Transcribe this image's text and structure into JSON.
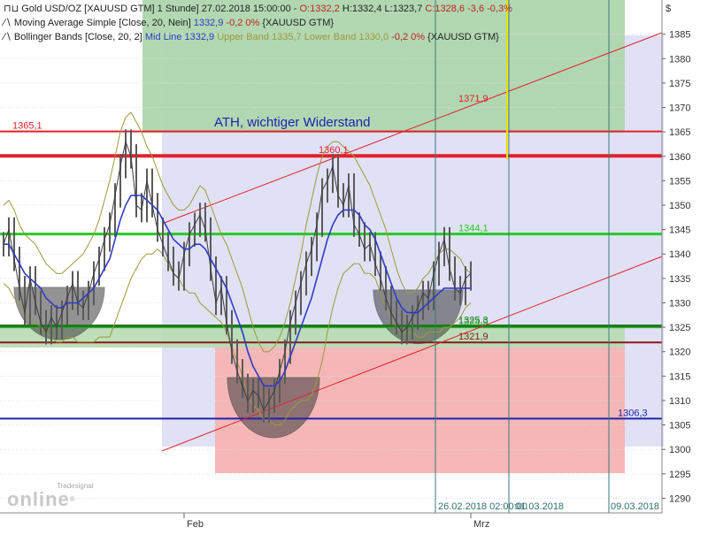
{
  "legend": {
    "l1": {
      "icon": "candles-icon",
      "main": "Gold USD/OZ [XAUUSD GTM]  1 Stunde] 27.02.2018 15:00:00 - ",
      "o": "O:1332,2",
      "h": " H:1332,4 L:1323,7 ",
      "c": "C:1328,6 -3,6 -0,3%"
    },
    "l2": {
      "icon": "line-icon",
      "main": "Moving Average Simple [Close, 20, Nein] ",
      "val": "1332,9",
      "chg": " -0,2 0%",
      "tail": " {XAUUSD GTM}"
    },
    "l3": {
      "icon": "line-icon",
      "main": "Bollinger Bands [Close, 20, 2] ",
      "mid": "Mid Line 1332,9",
      "up": " Upper Band 1335,7",
      "low": " Lower Band 1330,0",
      "chg": " -0,2 0%",
      "tail": " {XAUUSD GTM}"
    }
  },
  "logo": {
    "small": "Tradesignal",
    "big": "online",
    "registered": "®"
  },
  "colors": {
    "price": "#5a5a5a",
    "sma": "#2f3bc4",
    "bollinger": "#9c9a3c",
    "red_level": "#e3202a",
    "green_level": "#22cc22",
    "dark_green": "#1f7a1f",
    "dark_red": "#8a1a1a",
    "blue_level": "#2222aa",
    "yellow_line": "#f0e000"
  },
  "chart_data": {
    "type": "line",
    "title": "",
    "currency_label": "$",
    "x_labels": [
      {
        "label": "Feb",
        "bar": 34
      },
      {
        "label": "Mrz",
        "bar": 88
      }
    ],
    "bars_total": 122,
    "ylim": [
      1287,
      1392
    ],
    "y_ticks": [
      1290,
      1295,
      1300,
      1305,
      1310,
      1315,
      1320,
      1325,
      1330,
      1335,
      1340,
      1345,
      1350,
      1355,
      1360,
      1365,
      1370,
      1375,
      1380,
      1385
    ],
    "annotation_text": "ATH, wichtiger Widerstand",
    "date_labels": [
      "26.02.2018 02:00:00",
      "01.03.2018",
      "09.03.2018"
    ],
    "levels": [
      {
        "name": "ath",
        "value": 1365.1,
        "label": "1365,1",
        "color": "#e3202a",
        "width": 2
      },
      {
        "name": "major-resistance",
        "value": 1360.1,
        "label": "1360,1",
        "color": "#e3202a",
        "width": 4
      },
      {
        "name": "green-resistance",
        "value": 1344.1,
        "label": "1344,1",
        "color": "#22cc22",
        "width": 3
      },
      {
        "name": "upper-support",
        "value": 1325.3,
        "label": "1325,3",
        "color": "#1f7a1f",
        "width": 3
      },
      {
        "name": "mid-support",
        "value": 1324.9,
        "label": "1324,9",
        "color": "#22aa22",
        "width": 1
      },
      {
        "name": "lower-support",
        "value": 1321.9,
        "label": "1321,9",
        "color": "#8a1a1a",
        "width": 2
      },
      {
        "name": "deep-support",
        "value": 1306.3,
        "label": "1306,3",
        "color": "#2222aa",
        "width": 2
      }
    ],
    "channel_label": {
      "value": 1371.9,
      "label": "1371,9"
    },
    "price": [
      1342,
      1345,
      1339,
      1333,
      1328,
      1335,
      1330,
      1326,
      1324,
      1327,
      1325,
      1328,
      1331,
      1334,
      1330,
      1329,
      1332,
      1336,
      1339,
      1343,
      1346,
      1352,
      1358,
      1363,
      1360,
      1350,
      1349,
      1355,
      1350,
      1345,
      1342,
      1339,
      1336,
      1335,
      1340,
      1344,
      1346,
      1348,
      1345,
      1337,
      1330,
      1333,
      1326,
      1320,
      1316,
      1313,
      1310,
      1312,
      1311,
      1308,
      1310,
      1312,
      1316,
      1320,
      1326,
      1330,
      1334,
      1338,
      1341,
      1346,
      1353,
      1355,
      1358,
      1352,
      1350,
      1354,
      1346,
      1344,
      1341,
      1342,
      1338,
      1335,
      1331,
      1328,
      1326,
      1324,
      1325,
      1327,
      1329,
      1332,
      1331,
      1336,
      1340,
      1343,
      1337,
      1333,
      1332,
      1335,
      1336
    ],
    "sma": [
      1342,
      1342,
      1340,
      1338,
      1336,
      1335,
      1334,
      1333,
      1331,
      1330,
      1329,
      1329,
      1330,
      1330,
      1330,
      1331,
      1332,
      1333,
      1335,
      1337,
      1339,
      1343,
      1347,
      1350,
      1352,
      1352,
      1352,
      1351,
      1350,
      1349,
      1347,
      1345,
      1343,
      1342,
      1341,
      1341,
      1342,
      1342,
      1341,
      1339,
      1337,
      1335,
      1333,
      1330,
      1327,
      1324,
      1320,
      1317,
      1315,
      1313,
      1313,
      1313,
      1314,
      1316,
      1319,
      1322,
      1325,
      1328,
      1331,
      1335,
      1339,
      1343,
      1346,
      1348,
      1349,
      1349,
      1349,
      1348,
      1346,
      1345,
      1343,
      1340,
      1337,
      1334,
      1331,
      1329,
      1328,
      1328,
      1328,
      1329,
      1330,
      1331,
      1332,
      1333,
      1333,
      1333,
      1333,
      1333,
      1333
    ],
    "bb_upper": [
      1350,
      1351,
      1349,
      1346,
      1344,
      1343,
      1342,
      1340,
      1338,
      1337,
      1336,
      1336,
      1337,
      1338,
      1339,
      1340,
      1342,
      1344,
      1347,
      1351,
      1355,
      1360,
      1365,
      1368,
      1369,
      1367,
      1365,
      1362,
      1360,
      1357,
      1354,
      1352,
      1350,
      1349,
      1349,
      1350,
      1352,
      1354,
      1353,
      1350,
      1347,
      1344,
      1342,
      1339,
      1336,
      1333,
      1329,
      1325,
      1322,
      1320,
      1320,
      1321,
      1323,
      1326,
      1330,
      1335,
      1340,
      1346,
      1351,
      1356,
      1360,
      1362,
      1363,
      1363,
      1362,
      1361,
      1360,
      1358,
      1356,
      1354,
      1351,
      1348,
      1345,
      1341,
      1337,
      1334,
      1332,
      1332,
      1333,
      1335,
      1336,
      1338,
      1340,
      1341,
      1341,
      1340,
      1339,
      1337,
      1336
    ],
    "bb_lower": [
      1334,
      1333,
      1331,
      1330,
      1328,
      1327,
      1326,
      1325,
      1324,
      1323,
      1322,
      1322,
      1323,
      1323,
      1322,
      1322,
      1322,
      1322,
      1323,
      1323,
      1323,
      1326,
      1329,
      1332,
      1335,
      1337,
      1339,
      1340,
      1340,
      1341,
      1340,
      1338,
      1336,
      1335,
      1333,
      1332,
      1332,
      1330,
      1329,
      1328,
      1327,
      1326,
      1324,
      1321,
      1318,
      1315,
      1311,
      1309,
      1308,
      1306,
      1306,
      1305,
      1305,
      1306,
      1308,
      1309,
      1310,
      1310,
      1311,
      1314,
      1318,
      1324,
      1329,
      1333,
      1336,
      1337,
      1338,
      1338,
      1336,
      1336,
      1335,
      1332,
      1329,
      1327,
      1325,
      1324,
      1324,
      1324,
      1323,
      1323,
      1324,
      1324,
      1324,
      1325,
      1325,
      1326,
      1327,
      1329,
      1330
    ]
  }
}
